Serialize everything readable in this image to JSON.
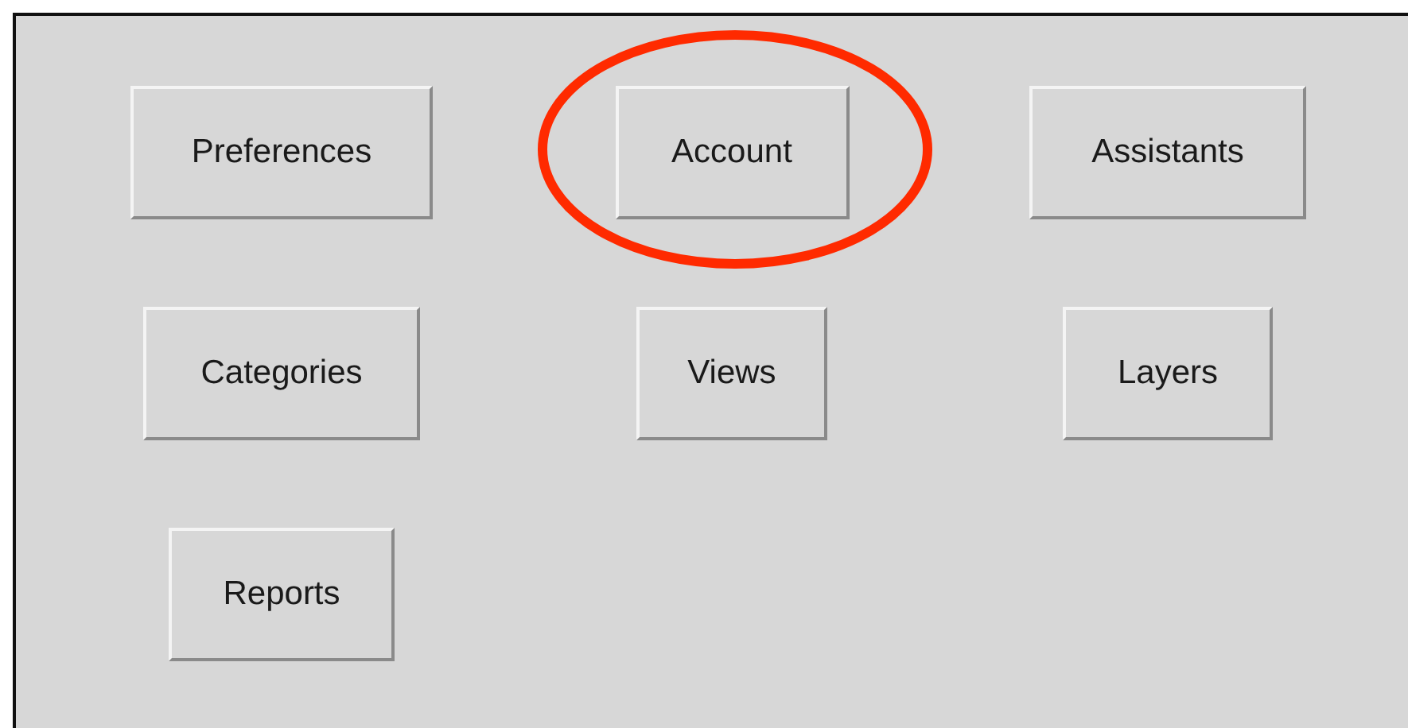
{
  "buttons": [
    {
      "label": "Preferences",
      "circled": false
    },
    {
      "label": "Account",
      "circled": true
    },
    {
      "label": "Assistants",
      "circled": false
    },
    {
      "label": "Categories",
      "circled": false
    },
    {
      "label": "Views",
      "circled": false
    },
    {
      "label": "Layers",
      "circled": false
    },
    {
      "label": "Reports",
      "circled": false
    }
  ]
}
